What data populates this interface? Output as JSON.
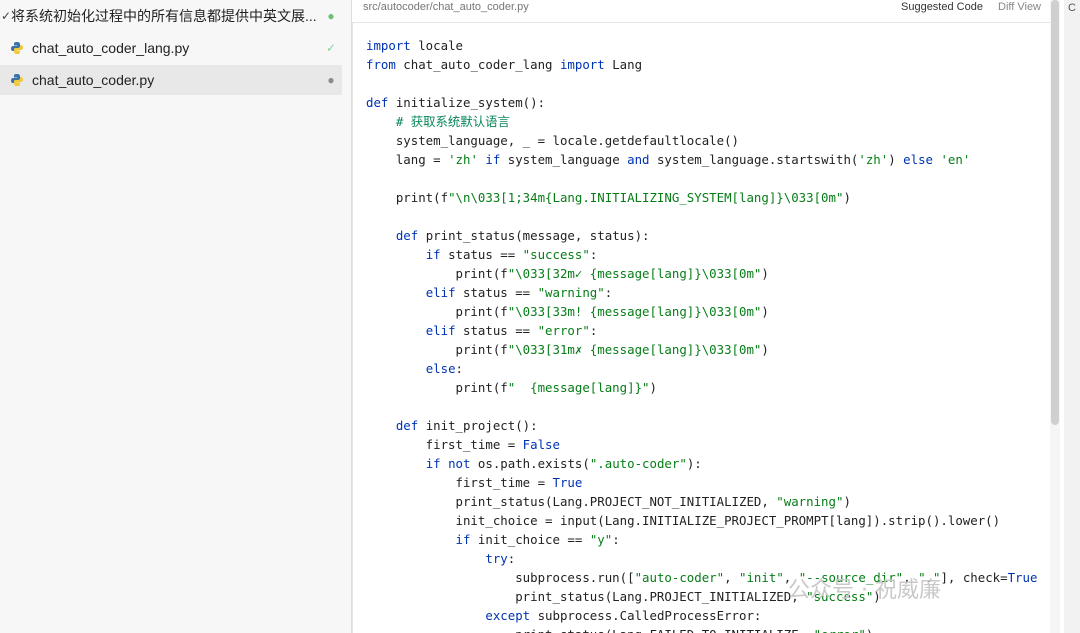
{
  "sidebar": {
    "items": [
      {
        "lead": "✓",
        "name": "将系统初始化过程中的所有信息都提供中英文展...",
        "status": "●",
        "icon": "none"
      },
      {
        "lead": "",
        "name": "chat_auto_coder_lang.py",
        "status": "✓",
        "icon": "python-icon"
      },
      {
        "lead": "",
        "name": "chat_auto_coder.py",
        "status": "●",
        "icon": "python-icon"
      }
    ]
  },
  "editor": {
    "path": "src/autocoder/chat_auto_coder.py",
    "suggested_label": "Suggested Code",
    "diff_label": "Diff View",
    "right_strip_letter": "C"
  },
  "code_lines": [
    "import locale",
    "from chat_auto_coder_lang import Lang",
    "",
    "def initialize_system():",
    "    # 获取系统默认语言",
    "    system_language, _ = locale.getdefaultlocale()",
    "    lang = 'zh' if system_language and system_language.startswith('zh') else 'en'",
    "",
    "    print(f\"\\n\\033[1;34m{Lang.INITIALIZING_SYSTEM[lang]}\\033[0m\")",
    "",
    "    def print_status(message, status):",
    "        if status == \"success\":",
    "            print(f\"\\033[32m✓ {message[lang]}\\033[0m\")",
    "        elif status == \"warning\":",
    "            print(f\"\\033[33m! {message[lang]}\\033[0m\")",
    "        elif status == \"error\":",
    "            print(f\"\\033[31m✗ {message[lang]}\\033[0m\")",
    "        else:",
    "            print(f\"  {message[lang]}\")",
    "",
    "    def init_project():",
    "        first_time = False",
    "        if not os.path.exists(\".auto-coder\"):",
    "            first_time = True",
    "            print_status(Lang.PROJECT_NOT_INITIALIZED, \"warning\")",
    "            init_choice = input(Lang.INITIALIZE_PROJECT_PROMPT[lang]).strip().lower()",
    "            if init_choice == \"y\":",
    "                try:",
    "                    subprocess.run([\"auto-coder\", \"init\", \"--source_dir\", \".\"], check=True",
    "                    print_status(Lang.PROJECT_INITIALIZED, \"success\")",
    "                except subprocess.CalledProcessError:",
    "                    print_status(Lang.FAILED_TO_INITIALIZE, \"error\")"
  ],
  "watermark": "公众号 · 祝威廉",
  "colors": {
    "accent_green": "#6cc070",
    "keyword": "#0033b3",
    "string": "#067d17"
  }
}
